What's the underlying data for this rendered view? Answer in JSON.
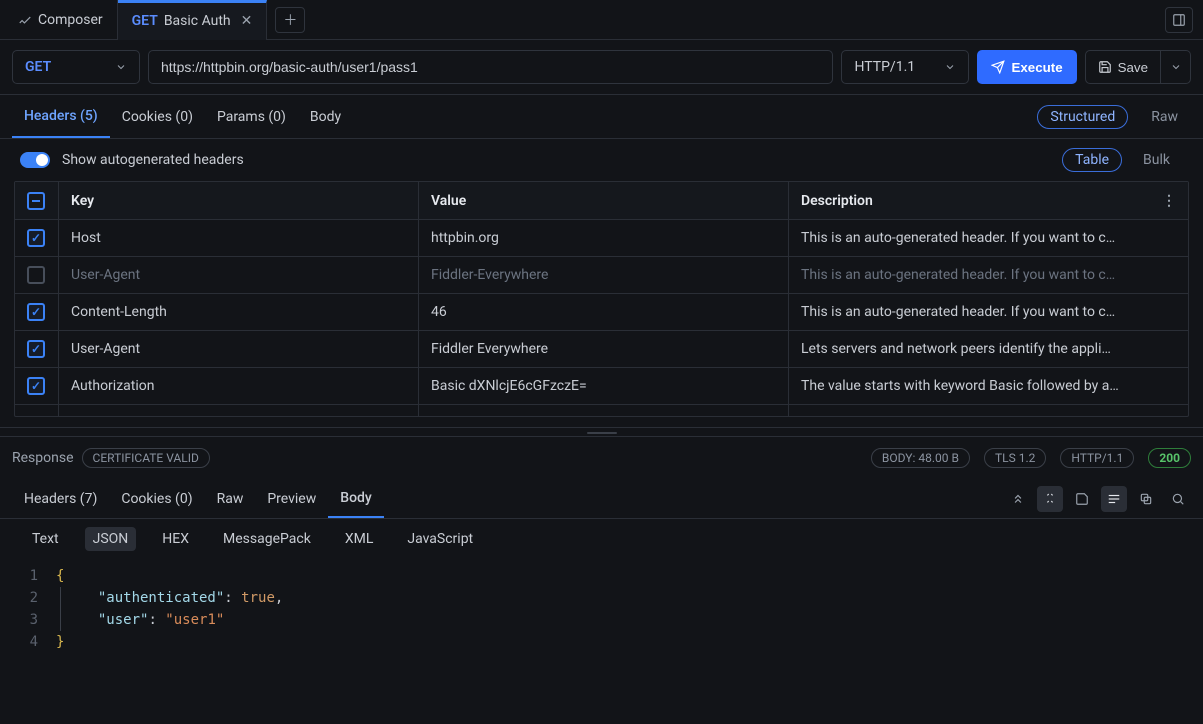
{
  "tabs": {
    "composer_label": "Composer",
    "active_method": "GET",
    "active_label": "Basic Auth"
  },
  "request": {
    "method": "GET",
    "url": "https://httpbin.org/basic-auth/user1/pass1",
    "http_version": "HTTP/1.1",
    "execute_label": "Execute",
    "save_label": "Save"
  },
  "reqtabs": {
    "headers": "Headers (5)",
    "cookies": "Cookies (0)",
    "params": "Params (0)",
    "body": "Body",
    "structured": "Structured",
    "raw": "Raw"
  },
  "switch": {
    "label": "Show autogenerated headers",
    "table": "Table",
    "bulk": "Bulk"
  },
  "table": {
    "head_key": "Key",
    "head_value": "Value",
    "head_desc": "Description",
    "rows": [
      {
        "checked": true,
        "key": "Host",
        "value": "httpbin.org",
        "desc": "This is an auto-generated header. If you want to c…"
      },
      {
        "checked": false,
        "key": "User-Agent",
        "value": "Fiddler-Everywhere",
        "desc": "This is an auto-generated header. If you want to c…"
      },
      {
        "checked": true,
        "key": "Content-Length",
        "value": "46",
        "desc": "This is an auto-generated header. If you want to c…"
      },
      {
        "checked": true,
        "key": "User-Agent",
        "value": "Fiddler Everywhere",
        "desc": "Lets servers and network peers identify the appli…"
      },
      {
        "checked": true,
        "key": "Authorization",
        "value": "Basic dXNlcjE6cGFzczE=",
        "desc": "The value starts with keyword Basic followed by a…"
      }
    ]
  },
  "response": {
    "title": "Response",
    "cert": "CERTIFICATE VALID",
    "body_size": "BODY: 48.00 B",
    "tls": "TLS 1.2",
    "http": "HTTP/1.1",
    "status": "200"
  },
  "resptabs": {
    "headers": "Headers (7)",
    "cookies": "Cookies (0)",
    "raw": "Raw",
    "preview": "Preview",
    "body": "Body"
  },
  "formats": {
    "text": "Text",
    "json": "JSON",
    "hex": "HEX",
    "msgpack": "MessagePack",
    "xml": "XML",
    "js": "JavaScript"
  },
  "body_json": {
    "line1_key": "\"authenticated\"",
    "line1_val": "true",
    "line2_key": "\"user\"",
    "line2_val": "\"user1\""
  }
}
